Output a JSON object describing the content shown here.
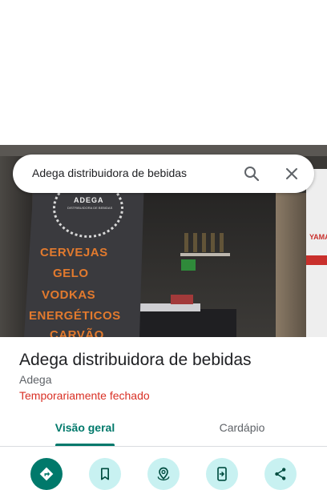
{
  "search": {
    "query": "Adega distribuidora de bebidas"
  },
  "hero": {
    "banner_brand": "ADEGA",
    "banner_subtitle": "DISTRIBUIDORA DE BEBIDAS",
    "banner_lines": [
      "CERVEJAS",
      "GELO",
      "VODKAS",
      "ENERGÉTICOS",
      "CARVÃO"
    ],
    "right_sign_text": "YAMA"
  },
  "place": {
    "title": "Adega distribuidora de bebidas",
    "category": "Adega",
    "status": "Temporariamente fechado"
  },
  "tabs": [
    {
      "label": "Visão geral",
      "active": true
    },
    {
      "label": "Cardápio",
      "active": false
    }
  ],
  "actions": [
    {
      "icon": "directions-icon"
    },
    {
      "icon": "bookmark-icon"
    },
    {
      "icon": "nearby-icon"
    },
    {
      "icon": "send-to-phone-icon"
    },
    {
      "icon": "share-icon"
    }
  ],
  "colors": {
    "accent": "#00796b",
    "action_bg": "#c8f1f1",
    "status_closed": "#d93025",
    "text_primary": "#202124",
    "text_secondary": "#5f6368"
  }
}
